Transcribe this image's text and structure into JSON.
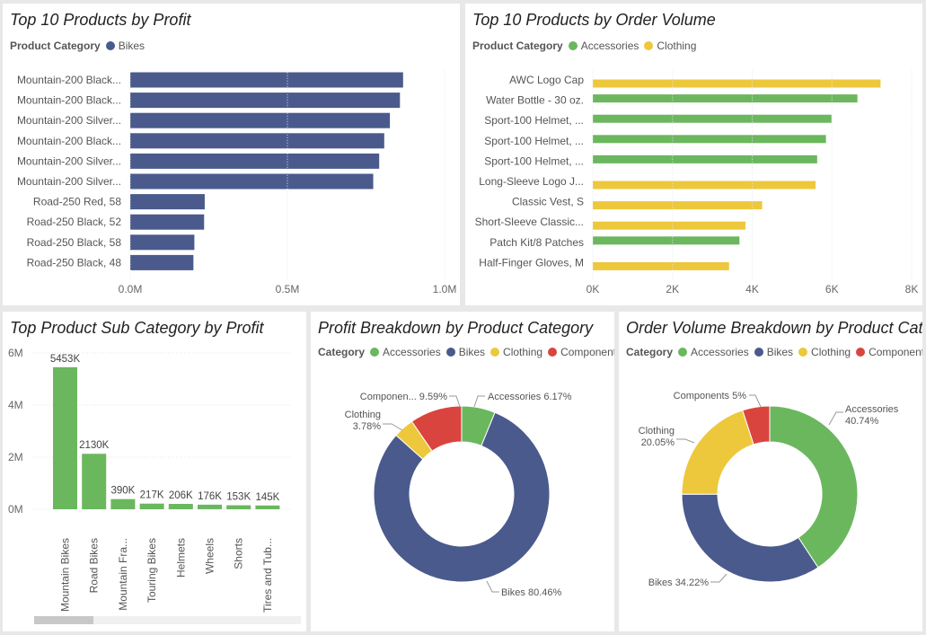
{
  "colors": {
    "bikes": "#4a5a8c",
    "accessories": "#6bb75e",
    "clothing": "#edc83c",
    "components": "#d9453e"
  },
  "panels": {
    "top_profit": {
      "title": "Top 10 Products by Profit",
      "legend_title": "Product Category",
      "legend_items": [
        {
          "label": "Bikes",
          "color": "#4a5a8c"
        }
      ]
    },
    "top_volume": {
      "title": "Top 10 Products by Order Volume",
      "legend_title": "Product Category",
      "legend_items": [
        {
          "label": "Accessories",
          "color": "#6bb75e"
        },
        {
          "label": "Clothing",
          "color": "#edc83c"
        }
      ]
    },
    "subcat": {
      "title": "Top Product Sub Category by Profit"
    },
    "profit_breakdown": {
      "title": "Profit Breakdown by Product Category",
      "legend_title": "Category",
      "legend_items": [
        {
          "label": "Accessories",
          "color": "#6bb75e"
        },
        {
          "label": "Bikes",
          "color": "#4a5a8c"
        },
        {
          "label": "Clothing",
          "color": "#edc83c"
        },
        {
          "label": "Components",
          "color": "#d9453e"
        }
      ]
    },
    "volume_breakdown": {
      "title": "Order Volume Breakdown by Product Cat...",
      "legend_title": "Category",
      "legend_items": [
        {
          "label": "Accessories",
          "color": "#6bb75e"
        },
        {
          "label": "Bikes",
          "color": "#4a5a8c"
        },
        {
          "label": "Clothing",
          "color": "#edc83c"
        },
        {
          "label": "Components",
          "color": "#d9453e"
        }
      ]
    }
  },
  "chart_data": [
    {
      "type": "bar",
      "orientation": "horizontal",
      "title": "Top 10 Products by Profit",
      "categories": [
        "Mountain-200 Black...",
        "Mountain-200 Black...",
        "Mountain-200 Silver...",
        "Mountain-200 Black...",
        "Mountain-200 Silver...",
        "Mountain-200 Silver...",
        "Road-250 Red, 58",
        "Road-250 Black, 52",
        "Road-250 Black, 58",
        "Road-250 Black, 48"
      ],
      "series": [
        {
          "name": "Bikes",
          "values": [
            868000,
            858000,
            826000,
            808000,
            792000,
            773000,
            237000,
            235000,
            204000,
            201000
          ]
        }
      ],
      "xlim": [
        0,
        1000000
      ],
      "xticks": [
        0,
        500000,
        1000000
      ],
      "xtick_labels": [
        "0.0M",
        "0.5M",
        "1.0M"
      ]
    },
    {
      "type": "bar",
      "orientation": "horizontal",
      "title": "Top 10 Products by Order Volume",
      "categories": [
        "AWC Logo Cap",
        "Water Bottle - 30 oz.",
        "Sport-100 Helmet, ...",
        "Sport-100 Helmet, ...",
        "Sport-100 Helmet, ...",
        "Long-Sleeve Logo J...",
        "Classic Vest, S",
        "Short-Sleeve Classic...",
        "Patch Kit/8 Patches",
        "Half-Finger Gloves, M"
      ],
      "product_category": [
        "Clothing",
        "Accessories",
        "Accessories",
        "Accessories",
        "Accessories",
        "Clothing",
        "Clothing",
        "Clothing",
        "Accessories",
        "Clothing"
      ],
      "values": [
        7220,
        6640,
        5990,
        5850,
        5630,
        5590,
        4250,
        3830,
        3680,
        3420
      ],
      "xlim": [
        0,
        8000
      ],
      "xticks": [
        0,
        2000,
        4000,
        6000,
        8000
      ],
      "xtick_labels": [
        "0K",
        "2K",
        "4K",
        "6K",
        "8K"
      ]
    },
    {
      "type": "bar",
      "orientation": "vertical",
      "title": "Top Product Sub Category by Profit",
      "categories": [
        "Mountain Bikes",
        "Road Bikes",
        "Mountain Fra...",
        "Touring Bikes",
        "Helmets",
        "Wheels",
        "Shorts",
        "Tires and Tub..."
      ],
      "values": [
        5453000,
        2130000,
        390000,
        217000,
        206000,
        176000,
        153000,
        145000
      ],
      "data_labels": [
        "5453K",
        "2130K",
        "390K",
        "217K",
        "206K",
        "176K",
        "153K",
        "145K"
      ],
      "ylim": [
        0,
        6000000
      ],
      "yticks": [
        0,
        2000000,
        4000000,
        6000000
      ],
      "ytick_labels": [
        "0M",
        "2M",
        "4M",
        "6M"
      ]
    },
    {
      "type": "pie",
      "donut": true,
      "title": "Profit Breakdown by Product Category",
      "slices": [
        {
          "label": "Accessories",
          "value": 6.17,
          "display": "Accessories 6.17%"
        },
        {
          "label": "Bikes",
          "value": 80.46,
          "display": "Bikes 80.46%"
        },
        {
          "label": "Clothing",
          "value": 3.78,
          "display": "3.78%"
        },
        {
          "label": "Components",
          "value": 9.59,
          "display": "Componen... 9.59%"
        }
      ],
      "extra_labels": {
        "clothing_name": "Clothing"
      }
    },
    {
      "type": "pie",
      "donut": true,
      "title": "Order Volume Breakdown by Product Category",
      "slices": [
        {
          "label": "Accessories",
          "value": 40.74,
          "display": "40.74%"
        },
        {
          "label": "Bikes",
          "value": 34.22,
          "display": "Bikes 34.22%"
        },
        {
          "label": "Clothing",
          "value": 20.05,
          "display": "20.05%"
        },
        {
          "label": "Components",
          "value": 5,
          "display": "Components 5%"
        }
      ],
      "extra_labels": {
        "accessories_name": "Accessories",
        "clothing_name": "Clothing"
      }
    }
  ]
}
